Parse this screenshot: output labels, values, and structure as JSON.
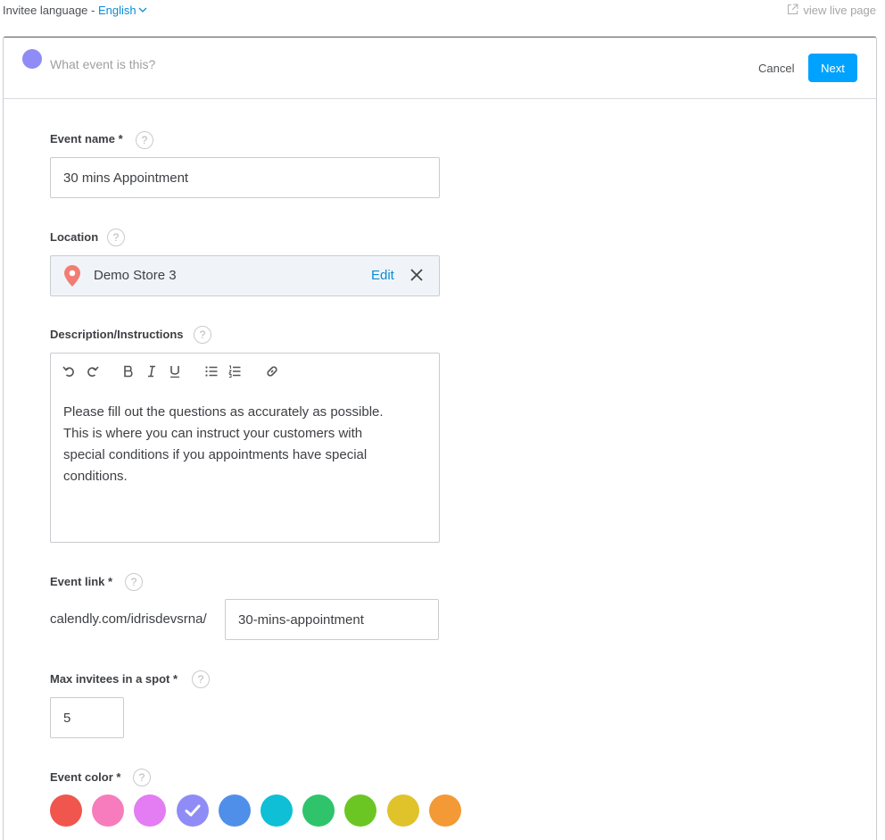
{
  "topbar": {
    "language_label": "Invitee language - ",
    "language_value": "English",
    "live_link": "view live page"
  },
  "header": {
    "title_placeholder": "What event is this?",
    "cancel_label": "Cancel",
    "next_label": "Next"
  },
  "form": {
    "event_name": {
      "label": "Event name *",
      "value": "30 mins Appointment"
    },
    "location": {
      "label": "Location",
      "value": "Demo Store 3",
      "edit_label": "Edit"
    },
    "description": {
      "label": "Description/Instructions",
      "text": "Please fill out the questions as accurately as possible. This is where you can instruct your customers with special conditions if you appointments have special conditions."
    },
    "event_link": {
      "label": "Event link *",
      "prefix": "calendly.com/idrisdevsrna/",
      "value": "30-mins-appointment"
    },
    "max_invitees": {
      "label": "Max invitees in a spot *",
      "value": "5"
    },
    "event_color": {
      "label": "Event color *",
      "swatches": [
        "#f0564d",
        "#f77cbd",
        "#e47cf4",
        "#8f8cf7",
        "#4f8fea",
        "#0fbfd6",
        "#2fc46b",
        "#6bc623",
        "#e0c22b",
        "#f39935"
      ],
      "selected_index": 3
    }
  },
  "help_text": "?",
  "accent_color": "#00a2ff"
}
